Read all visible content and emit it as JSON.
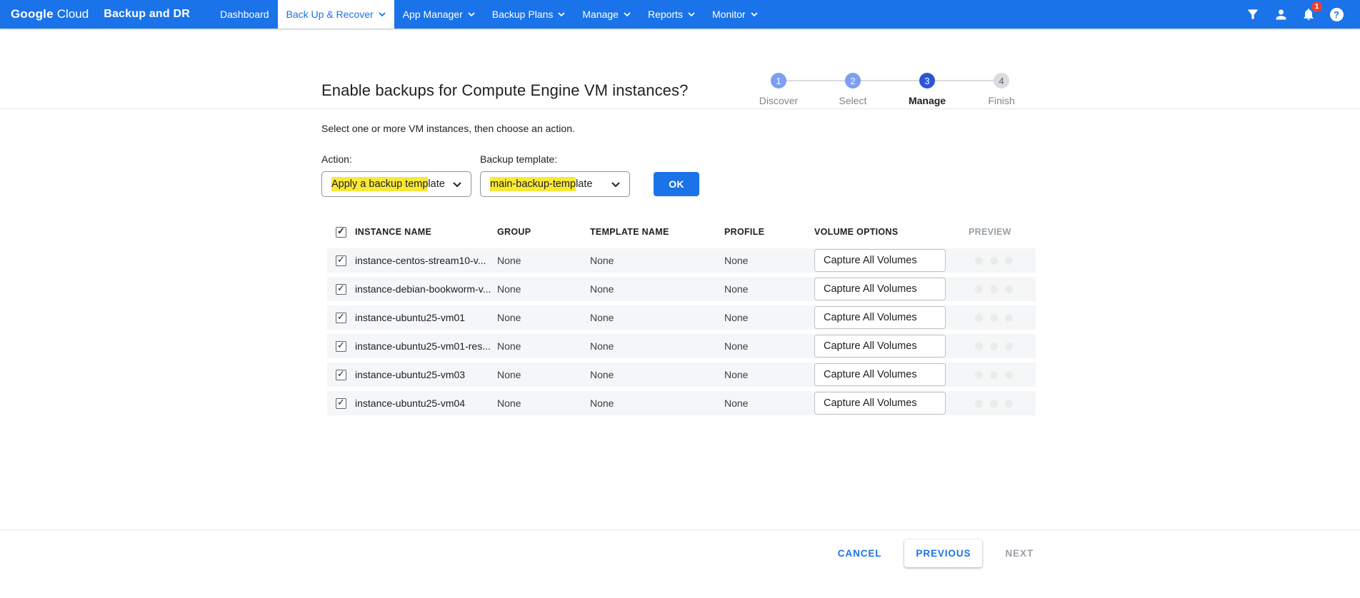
{
  "nav": {
    "brand": {
      "logo_primary": "Google",
      "logo_secondary": "Cloud",
      "product": "Backup and DR"
    },
    "items": [
      {
        "label": "Dashboard",
        "dropdown": false,
        "active": false
      },
      {
        "label": "Back Up & Recover",
        "dropdown": true,
        "active": true
      },
      {
        "label": "App Manager",
        "dropdown": true,
        "active": false
      },
      {
        "label": "Backup Plans",
        "dropdown": true,
        "active": false
      },
      {
        "label": "Manage",
        "dropdown": true,
        "active": false
      },
      {
        "label": "Reports",
        "dropdown": true,
        "active": false
      },
      {
        "label": "Monitor",
        "dropdown": true,
        "active": false
      }
    ],
    "notification_count": "1",
    "help_glyph": "?"
  },
  "wizard": {
    "title": "Enable backups for Compute Engine VM instances?",
    "steps": [
      {
        "number": "1",
        "label": "Discover",
        "state": "done"
      },
      {
        "number": "2",
        "label": "Select",
        "state": "done"
      },
      {
        "number": "3",
        "label": "Manage",
        "state": "active"
      },
      {
        "number": "4",
        "label": "Finish",
        "state": "pending"
      }
    ]
  },
  "content": {
    "instruction": "Select one or more VM instances, then choose an action.",
    "action_label": "Action:",
    "action_value_highlight": "Apply a backup temp",
    "action_value_rest": "late",
    "template_label": "Backup template:",
    "template_value_highlight": "main-backup-temp",
    "template_value_rest": "late",
    "ok_label": "OK"
  },
  "table": {
    "select_all_checked": true,
    "headers": [
      "INSTANCE NAME",
      "GROUP",
      "TEMPLATE NAME",
      "PROFILE",
      "VOLUME OPTIONS",
      "PREVIEW"
    ],
    "rows": [
      {
        "checked": true,
        "instance": "instance-centos-stream10-v...",
        "group": "None",
        "template": "None",
        "profile": "None",
        "volume": "Capture All Volumes"
      },
      {
        "checked": true,
        "instance": "instance-debian-bookworm-v...",
        "group": "None",
        "template": "None",
        "profile": "None",
        "volume": "Capture All Volumes"
      },
      {
        "checked": true,
        "instance": "instance-ubuntu25-vm01",
        "group": "None",
        "template": "None",
        "profile": "None",
        "volume": "Capture All Volumes"
      },
      {
        "checked": true,
        "instance": "instance-ubuntu25-vm01-res...",
        "group": "None",
        "template": "None",
        "profile": "None",
        "volume": "Capture All Volumes"
      },
      {
        "checked": true,
        "instance": "instance-ubuntu25-vm03",
        "group": "None",
        "template": "None",
        "profile": "None",
        "volume": "Capture All Volumes"
      },
      {
        "checked": true,
        "instance": "instance-ubuntu25-vm04",
        "group": "None",
        "template": "None",
        "profile": "None",
        "volume": "Capture All Volumes"
      }
    ]
  },
  "footer": {
    "cancel_label": "CANCEL",
    "previous_label": "PREVIOUS",
    "next_label": "NEXT"
  },
  "colors": {
    "nav_blue": "#1a73e8",
    "accent_blue": "#1a73e8",
    "step_active": "#2b54d8",
    "step_done": "#7d9ef5",
    "step_pending": "#dadce0",
    "highlight_yellow": "#f9e936",
    "badge_red": "#e94235",
    "row_bg": "#f4f6f8"
  }
}
